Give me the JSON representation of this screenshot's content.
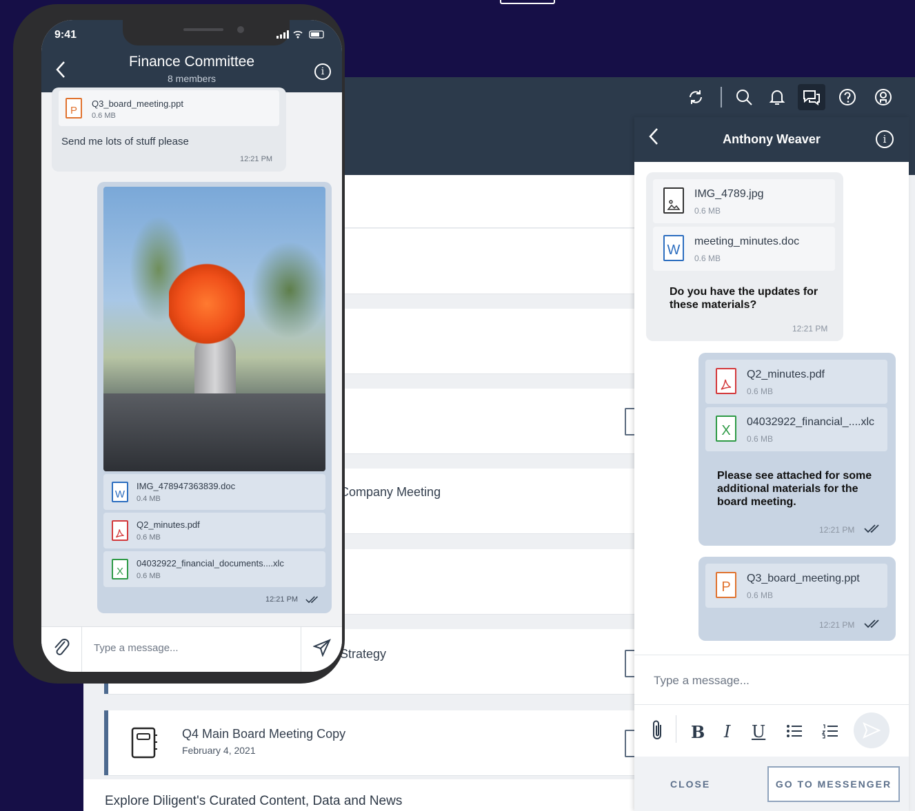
{
  "desktop": {
    "toolbar_icons": [
      "sync-icon",
      "search-icon",
      "bell-icon",
      "chat-icon",
      "help-icon",
      "account-icon"
    ],
    "meetings": [
      {
        "title": "Company Meeting",
        "date": ""
      },
      {
        "title": "Strategy",
        "date": ""
      },
      {
        "title": "Q4 Main Board Meeting Copy",
        "date": "February 4, 2021"
      }
    ],
    "explore_text": "Explore Diligent's Curated Content, Data and News"
  },
  "messenger": {
    "title": "Anthony Weaver",
    "messages": [
      {
        "direction": "in",
        "attachments": [
          {
            "name": "IMG_4789.jpg",
            "size": "0.6 MB",
            "type": "image"
          },
          {
            "name": "meeting_minutes.doc",
            "size": "0.6 MB",
            "type": "word"
          }
        ],
        "text": "Do you have the updates for these materials?",
        "time": "12:21 PM"
      },
      {
        "direction": "out",
        "attachments": [
          {
            "name": "Q2_minutes.pdf",
            "size": "0.6 MB",
            "type": "pdf"
          },
          {
            "name": "04032922_financial_....xlc",
            "size": "0.6 MB",
            "type": "excel"
          }
        ],
        "text": "Please see attached for some additional materials for the board meeting.",
        "time": "12:21 PM"
      },
      {
        "direction": "out",
        "attachments": [
          {
            "name": "Q3_board_meeting.ppt",
            "size": "0.6 MB",
            "type": "powerpoint"
          }
        ],
        "text": "",
        "time": "12:21 PM"
      }
    ],
    "input_placeholder": "Type a message...",
    "format_buttons": {
      "bold": "B",
      "italic": "I",
      "underline": "U"
    },
    "close_label": "CLOSE",
    "goto_label": "GO TO MESSENGER"
  },
  "phone": {
    "status_time": "9:41",
    "title": "Finance Committee",
    "subtitle": "8 members",
    "messages": [
      {
        "direction": "in",
        "attachments": [
          {
            "name": "Q3_board_meeting.ppt",
            "size": "0.6 MB",
            "type": "powerpoint"
          }
        ],
        "text": "Send me lots of stuff please",
        "time": "12:21 PM"
      },
      {
        "direction": "out",
        "image": "flower-photo",
        "attachments": [
          {
            "name": "IMG_478947363839.doc",
            "size": "0.4 MB",
            "type": "word"
          },
          {
            "name": "Q2_minutes.pdf",
            "size": "0.6 MB",
            "type": "pdf"
          },
          {
            "name": "04032922_financial_documents....xlc",
            "size": "0.6 MB",
            "type": "excel"
          }
        ],
        "time": "12:21 PM"
      }
    ],
    "input_placeholder": "Type a message..."
  },
  "colors": {
    "background": "#160f47",
    "header": "#2c3a4b",
    "outgoing_bubble": "#c8d4e3",
    "incoming_bubble": "#eceef1"
  }
}
